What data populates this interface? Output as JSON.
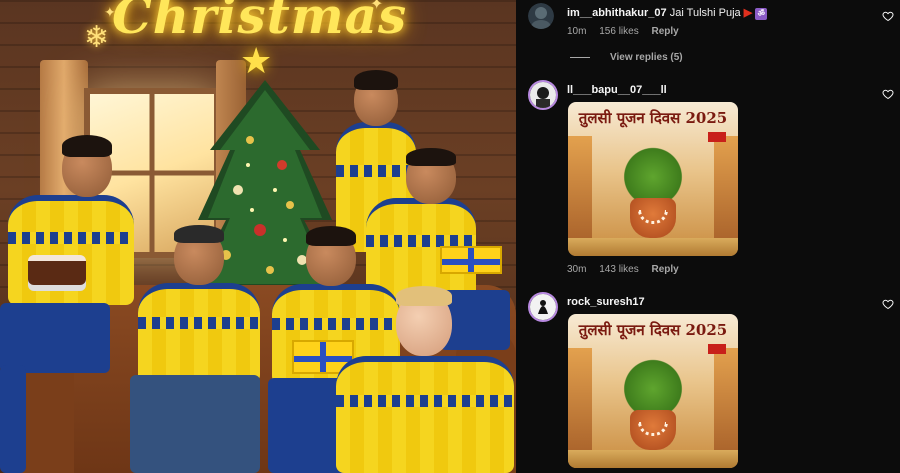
{
  "post_image": {
    "title_text": "Christmas"
  },
  "comments": [
    {
      "username": "im__abhithakur_07",
      "text": "Jai Tulshi Puja",
      "emoji_icons": [
        "triangular-flag-icon",
        "om-symbol-icon"
      ],
      "time": "10m",
      "likes": "156 likes",
      "reply_label": "Reply",
      "view_replies": "View replies (5)",
      "has_image": false
    },
    {
      "username": "ll___bapu__07___ll",
      "text": "",
      "time": "30m",
      "likes": "143 likes",
      "reply_label": "Reply",
      "has_image": true,
      "image_title": "तुलसी पूजन दिवस 2025"
    },
    {
      "username": "rock_suresh17",
      "text": "",
      "has_image": true,
      "image_title": "तुलसी पूजन दिवस 2025"
    }
  ],
  "colors": {
    "background": "#0c0c0c",
    "primary_text": "#f5f5f5",
    "secondary_text": "#a8a8a8",
    "accent_gold": "#ffe65a",
    "sweater_yellow": "#f5d51f",
    "sweater_blue": "#1d3f8f"
  }
}
